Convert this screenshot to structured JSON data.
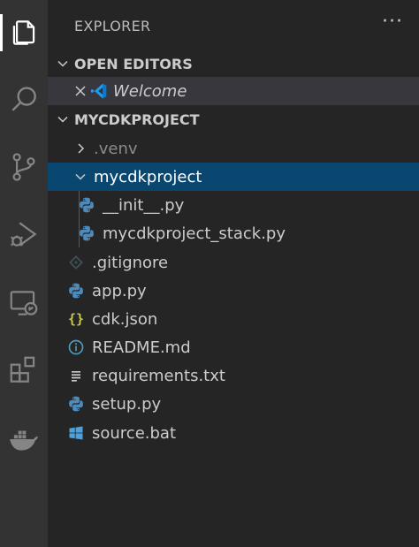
{
  "explorer": {
    "title": "EXPLORER",
    "more_label": "···"
  },
  "open_editors": {
    "header": "OPEN EDITORS",
    "items": [
      {
        "label": "Welcome",
        "icon": "vscode-icon"
      }
    ]
  },
  "project": {
    "header": "MYCDKPROJECT",
    "items": [
      {
        "label": ".venv",
        "type": "folder-collapsed"
      },
      {
        "label": "mycdkproject",
        "type": "folder-expanded"
      },
      {
        "label": "__init__.py",
        "type": "python-file"
      },
      {
        "label": "mycdkproject_stack.py",
        "type": "python-file"
      },
      {
        "label": ".gitignore",
        "type": "git-file"
      },
      {
        "label": "app.py",
        "type": "python-file"
      },
      {
        "label": "cdk.json",
        "type": "json-file"
      },
      {
        "label": "README.md",
        "type": "info-file"
      },
      {
        "label": "requirements.txt",
        "type": "text-file"
      },
      {
        "label": "setup.py",
        "type": "python-file"
      },
      {
        "label": "source.bat",
        "type": "windows-file"
      }
    ]
  },
  "colors": {
    "activity_bar": "#333333",
    "sidebar": "#252526",
    "selection": "#094771",
    "python": "#4b8bbe",
    "json": "#cbcb41",
    "info": "#519aba"
  }
}
